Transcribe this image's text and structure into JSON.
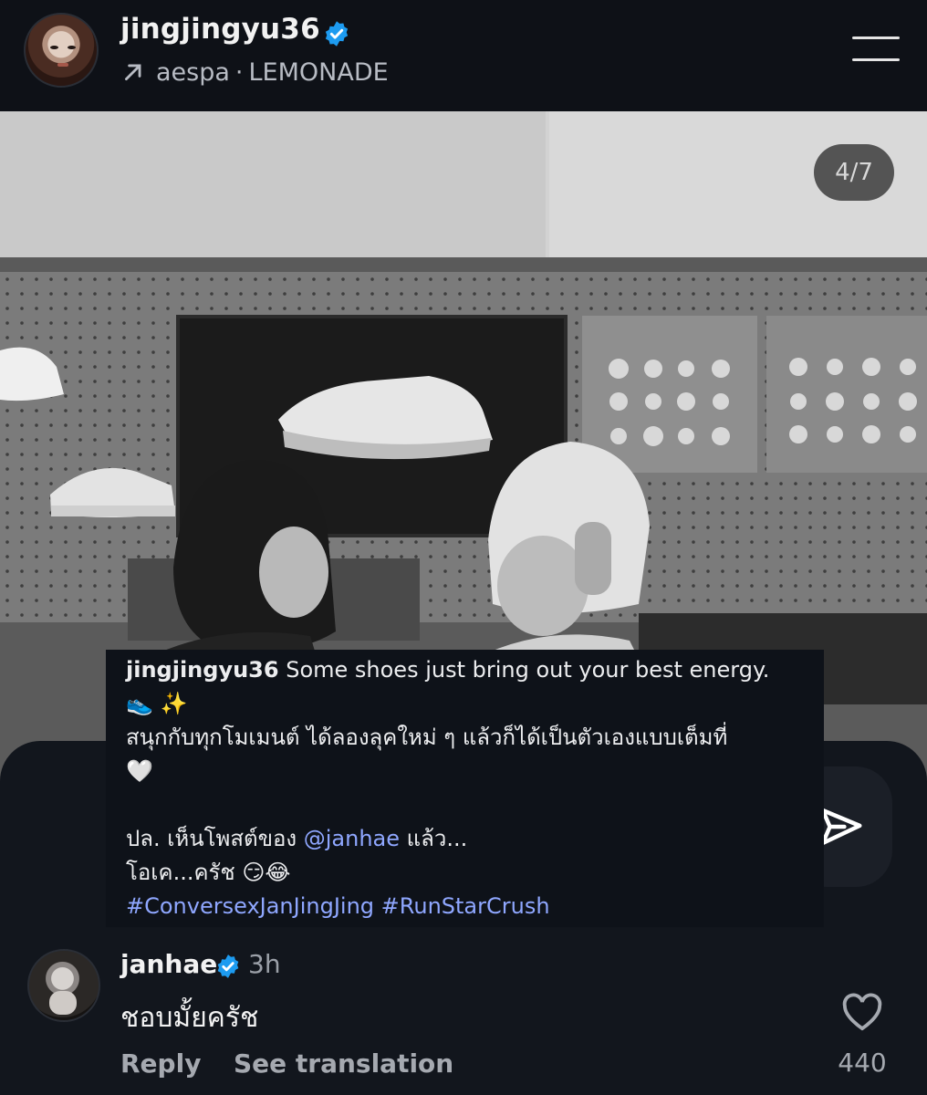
{
  "header": {
    "username": "jingjingyu36",
    "music_artist": "aespa",
    "music_separator": "·",
    "music_title": "LEMONADE"
  },
  "photo": {
    "counter": "4/7"
  },
  "caption": {
    "username": "jingjingyu36",
    "line1": "Some shoes just bring out your best energy.",
    "line2": "👟 ✨",
    "line3": "สนุกกับทุกโมเมนต์ ได้ลองลุคใหม่ ๆ แล้วก็ได้เป็นตัวเองแบบเต็มที่",
    "line4": "🤍",
    "ps_prefix": "ปล. เห็นโพสต์ของ ",
    "mention": "@janhae",
    "ps_suffix": " แล้ว...",
    "line6": "โอเค...ครัช 😏😂",
    "hashtags": "#ConversexJanJingJing #RunStarCrush"
  },
  "comment": {
    "username": "janhae",
    "time": "3h",
    "text": "ชอบมั้ยครัช",
    "reply_label": "Reply",
    "translate_label": "See translation",
    "like_count": "440"
  },
  "colors": {
    "background": "#0e1117",
    "verified_blue": "#1d9bf0",
    "link_blue": "#8fa7ff",
    "muted_text": "#a5a9b0"
  },
  "icons": [
    "verified-badge-icon",
    "music-arrow-icon",
    "menu-icon",
    "send-icon",
    "heart-icon"
  ]
}
